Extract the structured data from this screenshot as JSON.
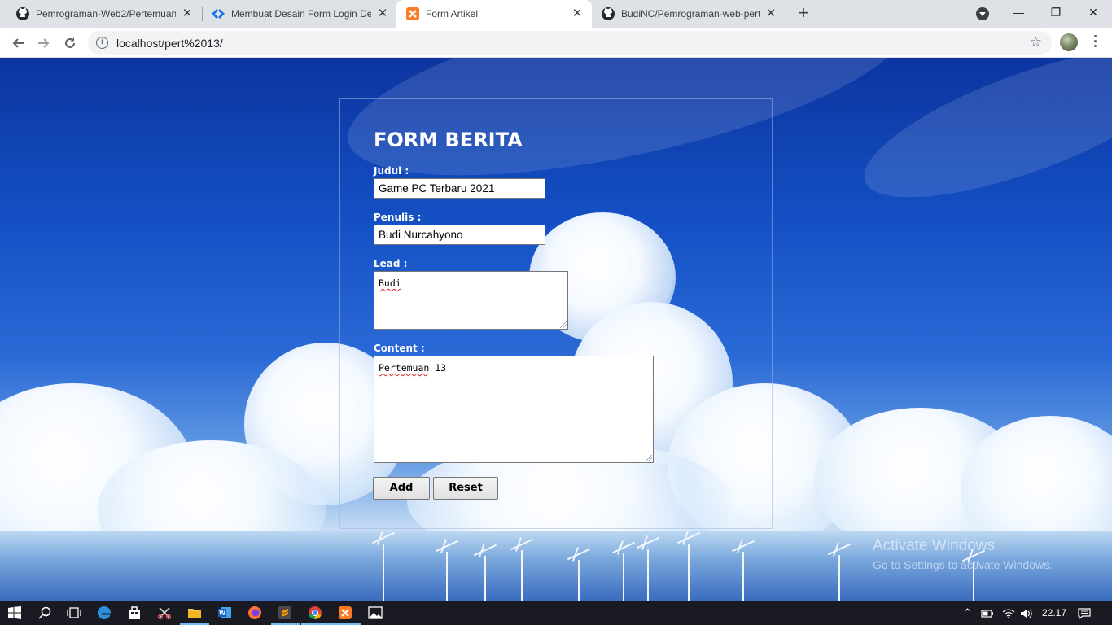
{
  "browser": {
    "tabs": [
      {
        "title": "Pemrograman-Web2/Pertemuan",
        "icon": "github-icon",
        "active": false
      },
      {
        "title": "Membuat Desain Form Login Den",
        "icon": "codepolitan-icon",
        "active": false
      },
      {
        "title": "Form Artikel",
        "icon": "xampp-icon",
        "active": true
      },
      {
        "title": "BudiNC/Pemrograman-web-pert",
        "icon": "github-icon",
        "active": false
      }
    ],
    "url": "localhost/pert%2013/",
    "window_controls": {
      "minimize": "—",
      "restore": "❐",
      "close": "✕"
    }
  },
  "form": {
    "title": "FORM BERITA",
    "judul": {
      "label": "Judul :",
      "value": "Game PC Terbaru 2021"
    },
    "penulis": {
      "label": "Penulis :",
      "value": "Budi Nurcahyono"
    },
    "lead": {
      "label": "Lead :",
      "value": "Budi"
    },
    "content": {
      "label": "Content :",
      "value_word": "Pertemuan",
      "value_rest": " 13"
    },
    "buttons": {
      "add": "Add",
      "reset": "Reset"
    }
  },
  "watermark": {
    "line1": "Activate Windows",
    "line2": "Go to Settings to activate Windows."
  },
  "taskbar": {
    "apps": [
      "windows-start-icon",
      "search-icon",
      "task-view-icon",
      "edge-icon",
      "store-icon",
      "snipping-icon",
      "file-explorer-icon",
      "word-icon",
      "firefox-icon",
      "sublime-icon",
      "chrome-icon",
      "xampp-icon",
      "photos-icon"
    ],
    "time": "22.17"
  },
  "colors": {
    "accent": "#76b9ed",
    "sky_top": "#0c35a0",
    "form_text": "#ffffff"
  }
}
